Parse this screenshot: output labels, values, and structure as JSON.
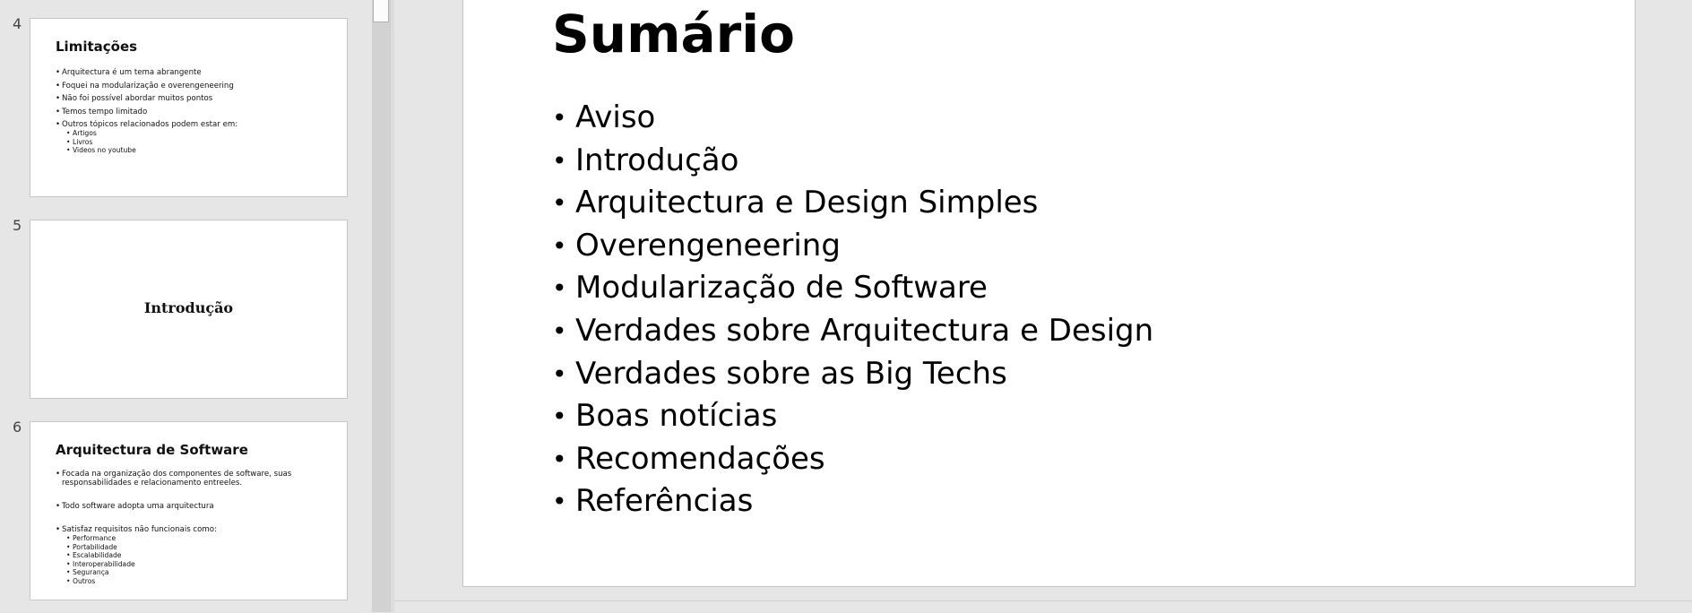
{
  "thumbnails": [
    {
      "number": "4",
      "title": "Limitações",
      "bullets": [
        {
          "text": "Arquitectura é um tema abrangente",
          "level": 1
        },
        {
          "text": "Foquei na modularização e overengeneering",
          "level": 1
        },
        {
          "text": "Não foi possível abordar muitos pontos",
          "level": 1
        },
        {
          "text": "Temos tempo limitado",
          "level": 1
        },
        {
          "text": "Outros tópicos relacionados podem estar em:",
          "level": 1
        },
        {
          "text": "Artigos",
          "level": 2
        },
        {
          "text": "Livros",
          "level": 2
        },
        {
          "text": "Videos no youtube",
          "level": 2
        }
      ]
    },
    {
      "number": "5",
      "title": "Introdução"
    },
    {
      "number": "6",
      "title": "Arquitectura de Software",
      "bullets": [
        {
          "text": "Focada na organização dos componentes de software, suas responsabilidades e relacionamento entreeles.",
          "level": 1
        },
        {
          "text": "Todo software adopta uma arquitectura",
          "level": 1
        },
        {
          "text": "Satisfaz requisitos não funcionais como:",
          "level": 1
        },
        {
          "text": "Performance",
          "level": 2
        },
        {
          "text": "Portabilidade",
          "level": 2
        },
        {
          "text": "Escalabilidade",
          "level": 2
        },
        {
          "text": "Interoperabilidade",
          "level": 2
        },
        {
          "text": "Segurança",
          "level": 2
        },
        {
          "text": "Outros",
          "level": 2
        }
      ]
    }
  ],
  "slide": {
    "title": "Sumário",
    "items": [
      "Aviso",
      "Introdução",
      "Arquitectura e Design Simples",
      "Overengeneering",
      "Modularização de Software",
      "Verdades sobre Arquitectura e Design",
      "Verdades sobre as Big Techs",
      "Boas notícias",
      "Recomendações",
      "Referências"
    ]
  }
}
